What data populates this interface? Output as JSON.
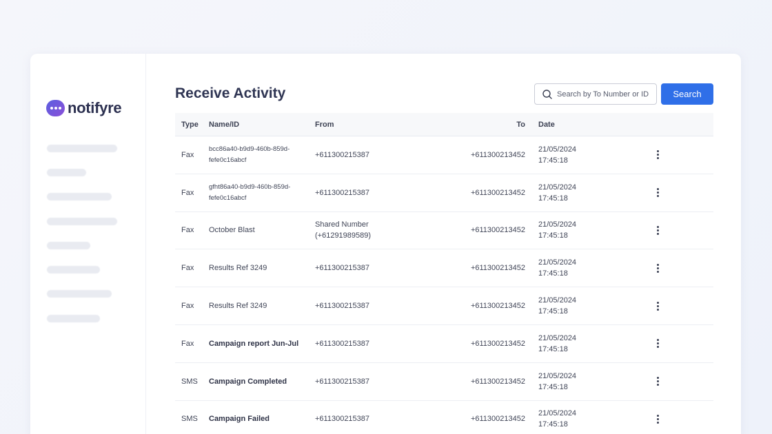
{
  "app": {
    "logo_text": "notifyre"
  },
  "page": {
    "title": "Receive Activity"
  },
  "search": {
    "placeholder": "Search by To Number or ID",
    "button_label": "Search"
  },
  "table": {
    "headers": {
      "type": "Type",
      "name": "Name/ID",
      "from": "From",
      "to": "To",
      "date": "Date"
    },
    "rows": [
      {
        "type": "Fax",
        "name": "bcc86a40-b9d9-460b-859d-fefe0c16abcf",
        "from": "+611300215387",
        "to": "+611300213452",
        "date": "21/05/2024",
        "time": "17:45:18"
      },
      {
        "type": "Fax",
        "name": "gfht86a40-b9d9-460b-859d-fefe0c16abcf",
        "from": "+611300215387",
        "to": "+611300213452",
        "date": "21/05/2024",
        "time": "17:45:18"
      },
      {
        "type": "Fax",
        "name": "October Blast",
        "from": "Shared Number",
        "from_detail": "(+61291989589)",
        "to": "+611300213452",
        "date": "21/05/2024",
        "time": "17:45:18"
      },
      {
        "type": "Fax",
        "name": "Results Ref 3249",
        "from": "+611300215387",
        "to": "+611300213452",
        "date": "21/05/2024",
        "time": "17:45:18"
      },
      {
        "type": "Fax",
        "name": "Results Ref 3249",
        "from": "+611300215387",
        "to": "+611300213452",
        "date": "21/05/2024",
        "time": "17:45:18"
      },
      {
        "type": "Fax",
        "name": "Campaign report Jun-Jul",
        "from": "+611300215387",
        "to": "+611300213452",
        "date": "21/05/2024",
        "time": "17:45:18"
      },
      {
        "type": "SMS",
        "name": "Campaign Completed",
        "from": "+611300215387",
        "to": "+611300213452",
        "date": "21/05/2024",
        "time": "17:45:18"
      },
      {
        "type": "SMS",
        "name": "Campaign Failed",
        "from": "+611300215387",
        "to": "+611300213452",
        "date": "21/05/2024",
        "time": "17:45:18"
      }
    ]
  },
  "colors": {
    "accent": "#2f6fe8",
    "brand": "#6e57de"
  }
}
